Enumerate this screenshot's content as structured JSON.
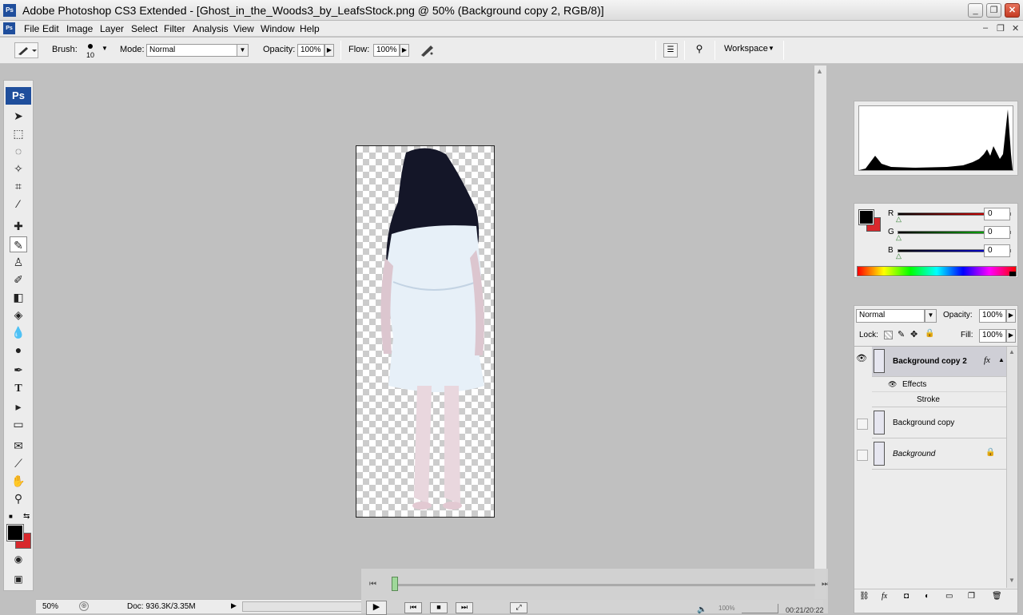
{
  "app": {
    "ps_badge": "Ps",
    "title": "Adobe Photoshop CS3 Extended - [Ghost_in_the_Woods3_by_LeafsStock.png @ 50% (Background copy 2, RGB/8)]"
  },
  "menu": [
    "File",
    "Edit",
    "Image",
    "Layer",
    "Select",
    "Filter",
    "Analysis",
    "View",
    "Window",
    "Help"
  ],
  "options": {
    "brush_label": "Brush:",
    "brush_size": "10",
    "mode_label": "Mode:",
    "mode_value": "Normal",
    "opacity_label": "Opacity:",
    "opacity_value": "100%",
    "flow_label": "Flow:",
    "flow_value": "100%",
    "workspace_label": "Workspace"
  },
  "toolbox": {
    "logo": "Ps"
  },
  "status": {
    "zoom": "50%",
    "doc": "Doc: 936.3K/3.35M"
  },
  "video": {
    "volume": "100%",
    "time": "00:21/20:22"
  },
  "color": {
    "r_label": "R",
    "g_label": "G",
    "b_label": "B",
    "r_value": "0",
    "g_value": "0",
    "b_value": "0",
    "foreground": "#000000",
    "background": "#d8282c"
  },
  "layers": {
    "blend_mode": "Normal",
    "opacity_label": "Opacity:",
    "opacity_value": "100%",
    "lock_label": "Lock:",
    "fill_label": "Fill:",
    "fill_value": "100%",
    "rows": [
      {
        "name": "Background copy 2",
        "fx": "fx"
      },
      {
        "name": "Background copy"
      },
      {
        "name": "Background"
      }
    ],
    "effects_label": "Effects",
    "stroke_label": "Stroke"
  }
}
